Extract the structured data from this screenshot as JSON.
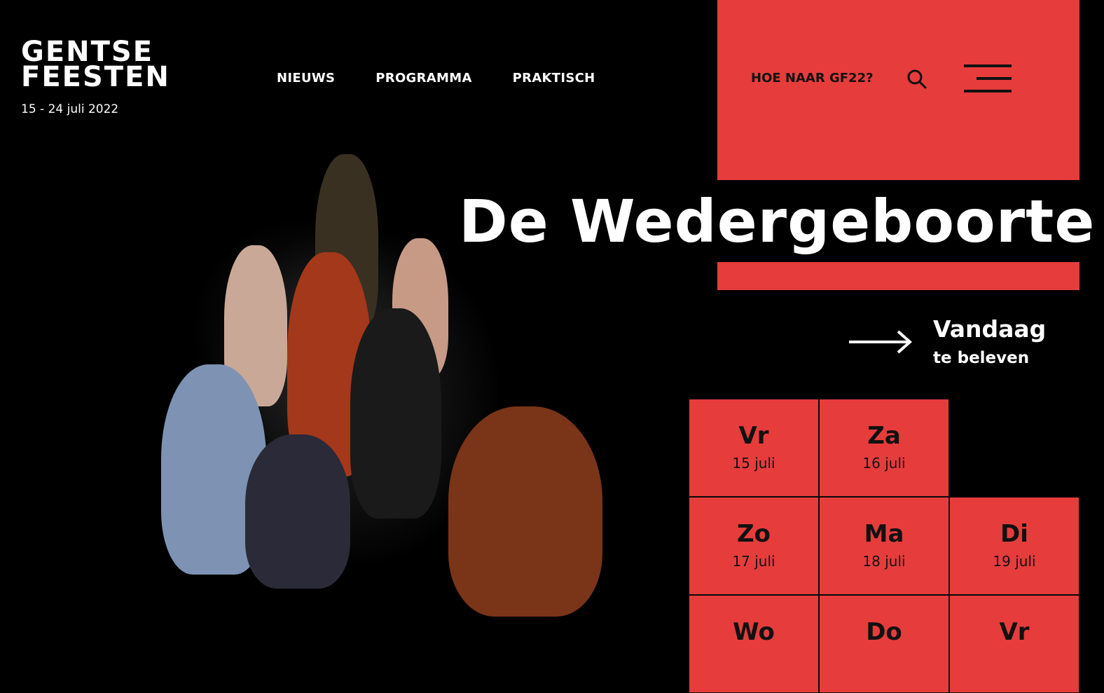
{
  "logo": {
    "line1": "GENTSE",
    "line2": "FEESTEN",
    "dates": "15 - 24 juli 2022"
  },
  "nav": {
    "items": [
      "NIEUWS",
      "PROGRAMMA",
      "PRAKTISCH"
    ]
  },
  "header": {
    "route_link": "HOE NAAR GF22?",
    "search_icon": "search-icon",
    "menu_icon": "hamburger-menu-icon"
  },
  "hero": {
    "title": "De Wedergeboorte"
  },
  "today": {
    "title": "Vandaag",
    "subtitle": "te beleven",
    "icon": "arrow-right-icon"
  },
  "days": [
    {
      "name": "Vr",
      "date": "15 juli"
    },
    {
      "name": "Za",
      "date": "16 juli"
    },
    {
      "name": "Zo",
      "date": "17 juli"
    },
    {
      "name": "Ma",
      "date": "18 juli"
    },
    {
      "name": "Di",
      "date": "19 juli"
    },
    {
      "name": "Wo",
      "date": ""
    },
    {
      "name": "Do",
      "date": ""
    },
    {
      "name": "Vr",
      "date": ""
    }
  ],
  "colors": {
    "accent": "#e63c3c",
    "background": "#000000",
    "text": "#ffffff"
  }
}
